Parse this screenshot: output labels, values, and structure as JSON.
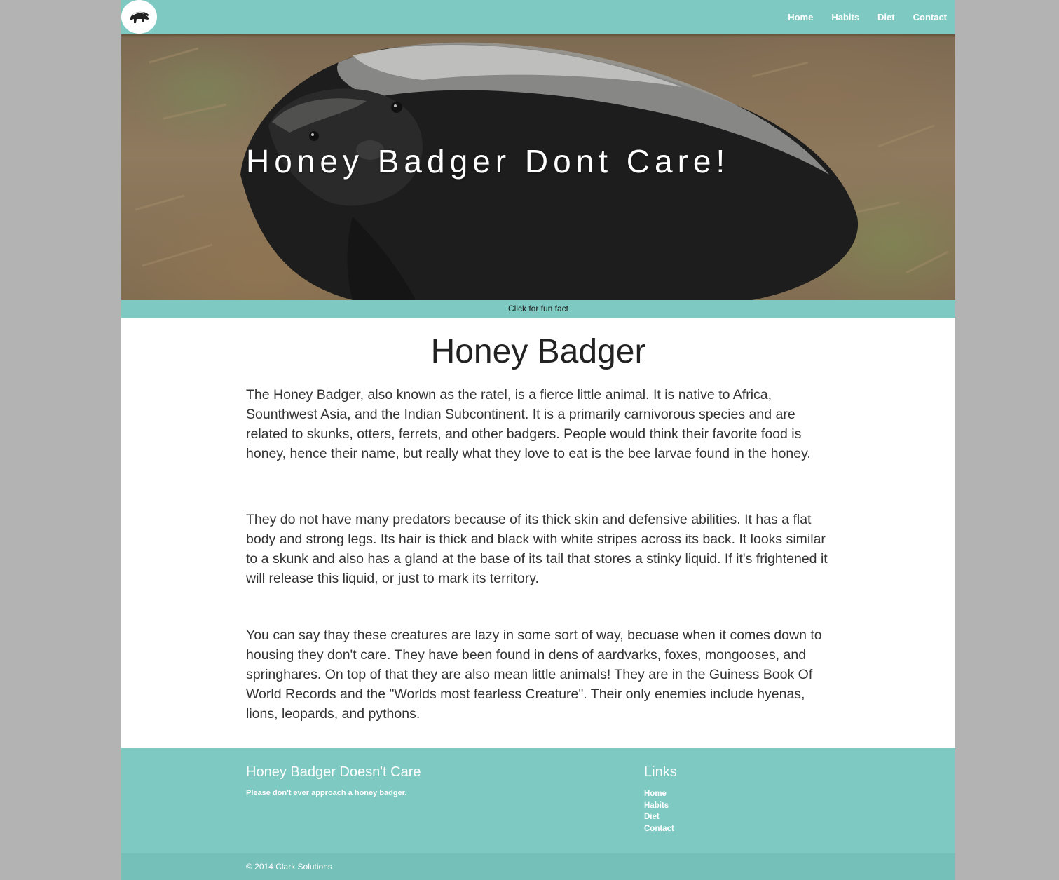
{
  "nav": {
    "links": [
      "Home",
      "Habits",
      "Diet",
      "Contact"
    ]
  },
  "hero": {
    "title": "Honey Badger Dont Care!",
    "fun_fact_label": "Click for fun fact"
  },
  "main": {
    "title": "Honey Badger",
    "paragraphs": [
      "The Honey Badger, also known as the ratel, is a fierce little animal. It is native to Africa, Sounthwest Asia, and the Indian Subcontinent. It is a primarily carnivorous species and are related to skunks, otters, ferrets, and other badgers. People would think their favorite food is honey, hence their name, but really what they love to eat is the bee larvae found in the honey.",
      "They do not have many predators because of its thick skin and defensive abilities. It has a flat body and strong legs. Its hair is thick and black with white stripes across its back. It looks similar to a skunk and also has a gland at the base of its tail that stores a stinky liquid. If it's frightened it will release this liquid, or just to mark its territory.",
      "You can say thay these creatures are lazy in some sort of way, becuase when it comes down to housing they don't care. They have been found in dens of aardvarks, foxes, mongooses, and springhares. On top of that they are also mean little animals! They are in the Guiness Book Of World Records and the \"Worlds most fearless Creature\". Their only enemies include hyenas, lions, leopards, and pythons."
    ]
  },
  "footer": {
    "about_title": "Honey Badger Doesn't Care",
    "about_text": "Please don't ever approach a honey badger.",
    "links_title": "Links",
    "links": [
      "Home",
      "Habits",
      "Diet",
      "Contact"
    ],
    "copyright": "© 2014 Clark Solutions"
  },
  "colors": {
    "accent": "#7ecac2",
    "background": "#b3b3b3"
  },
  "icons": {
    "logo": "honey-badger-logo-icon"
  }
}
